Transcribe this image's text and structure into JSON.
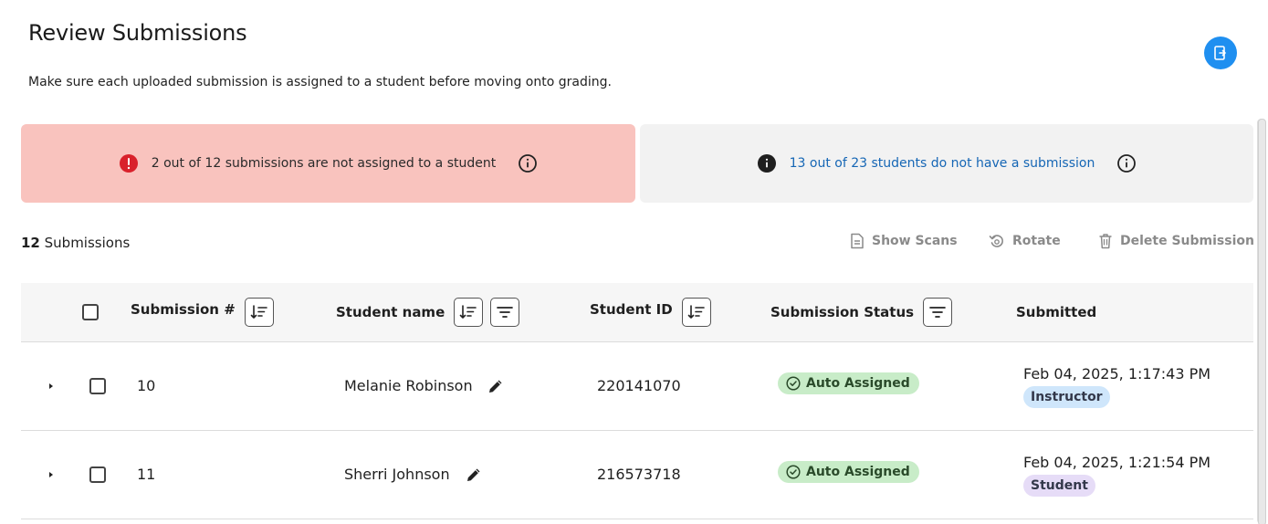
{
  "header": {
    "title": "Review Submissions",
    "description": "Make sure each uploaded submission is assigned to a student before moving onto grading."
  },
  "alerts": {
    "unassigned": "2 out of 12 submissions are not assigned to a student",
    "missing": "13 out of 23 students do not have a submission"
  },
  "summary": {
    "count": "12",
    "count_label": " Submissions"
  },
  "toolbar": {
    "show_scans": "Show Scans",
    "rotate": "Rotate",
    "delete": "Delete Submission"
  },
  "table": {
    "columns": {
      "submission_num": "Submission #",
      "student_name": "Student name",
      "student_id": "Student ID",
      "status": "Submission Status",
      "submitted": "Submitted"
    },
    "rows": [
      {
        "submission": "10",
        "name": "Melanie Robinson",
        "student_id": "220141070",
        "status": "Auto Assigned",
        "date": "Feb 04, 2025, 1:17:43 PM",
        "role": "Instructor"
      },
      {
        "submission": "11",
        "name": "Sherri Johnson",
        "student_id": "216573718",
        "status": "Auto Assigned",
        "date": "Feb 04, 2025, 1:21:54 PM",
        "role": "Student"
      }
    ]
  },
  "colors": {
    "accent": "#1f8ff0",
    "error_bg": "#f9c3be",
    "error_icon": "#d9212b",
    "link": "#1566b5",
    "status_bg": "#c8ecc8",
    "role_instructor_bg": "#cfe6fb",
    "role_student_bg": "#e6dcf7"
  }
}
